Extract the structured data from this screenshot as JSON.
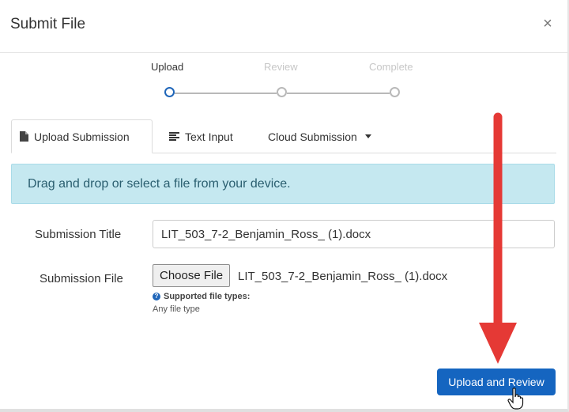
{
  "dialog": {
    "title": "Submit File",
    "close_symbol": "×"
  },
  "stepper": {
    "steps": [
      {
        "label": "Upload",
        "state": "active"
      },
      {
        "label": "Review",
        "state": "inactive"
      },
      {
        "label": "Complete",
        "state": "inactive"
      }
    ]
  },
  "tabs": [
    {
      "label": "Upload Submission",
      "icon": "document-icon",
      "active": true
    },
    {
      "label": "Text Input",
      "icon": "text-lines-icon",
      "active": false
    },
    {
      "label": "Cloud Submission",
      "icon": "caret-down-icon",
      "active": false
    }
  ],
  "banner": {
    "text": "Drag and drop or select a file from your device."
  },
  "form": {
    "title_label": "Submission Title",
    "title_value": "LIT_503_7-2_Benjamin_Ross_ (1).docx",
    "file_label": "Submission File",
    "choose_file_label": "Choose File",
    "file_name": "LIT_503_7-2_Benjamin_Ross_ (1).docx",
    "supported_label": "Supported file types:",
    "supported_value": "Any file type"
  },
  "actions": {
    "primary_label": "Upload and Review"
  },
  "colors": {
    "accent": "#1565c0",
    "banner_bg": "#c5e8f0",
    "annotation_arrow": "#e53935"
  }
}
